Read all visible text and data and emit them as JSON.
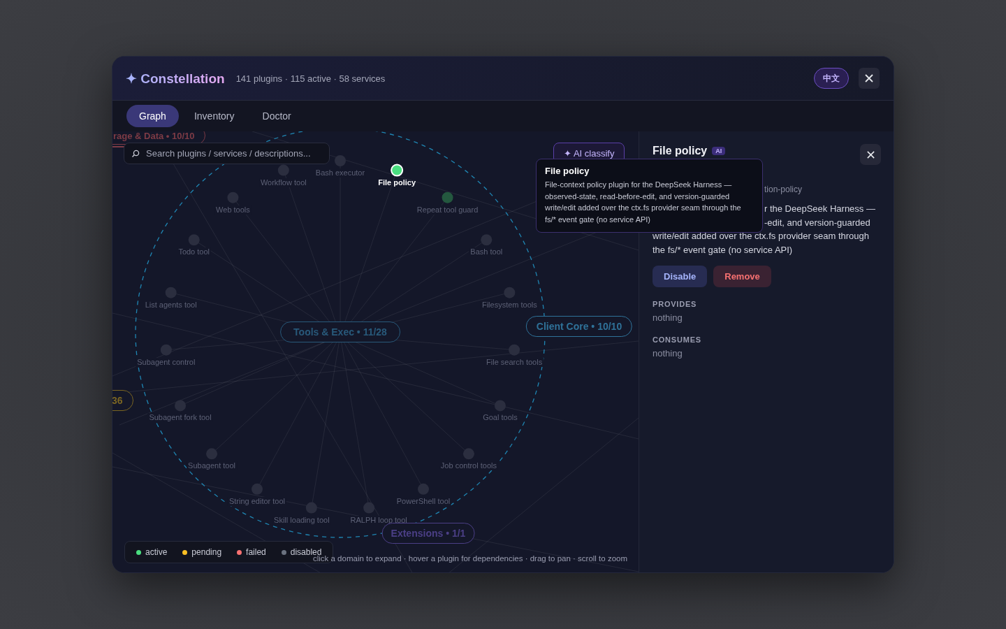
{
  "window": {
    "title": "✦ Constellation",
    "stats": "141 plugins · 115 active · 58 services",
    "language_button": "中文"
  },
  "tabs": [
    {
      "label": "Graph",
      "selected": true
    },
    {
      "label": "Inventory",
      "selected": false
    },
    {
      "label": "Doctor",
      "selected": false
    }
  ],
  "graph": {
    "search": {
      "placeholder": "Search plugins / services / descriptions..."
    },
    "ai_button": "✦ AI classify",
    "domains": [
      {
        "label": "rage & Data • 10/10",
        "color": "#7d3b45",
        "expanded": false
      },
      {
        "label": "Client Core • 10/10",
        "color": "#2f7299",
        "expanded": false
      },
      {
        "label": "Tools & Exec • 11/28",
        "color": "#28597a",
        "expanded": true
      },
      {
        "label": "36",
        "color": "#7a6522",
        "expanded": false
      },
      {
        "label": "Extensions • 1/1",
        "color": "#4b3f86",
        "expanded": false
      }
    ],
    "plugins": [
      {
        "name": "Bash executor",
        "color": "#2b2e3f",
        "dimmed": true
      },
      {
        "name": "Workflow tool",
        "color": "#2b2e3f",
        "dimmed": true
      },
      {
        "name": "File policy",
        "color": "#4ade80",
        "dimmed": false
      },
      {
        "name": "Web tools",
        "color": "#2b2e3f",
        "dimmed": true
      },
      {
        "name": "Repeat tool guard",
        "color": "#24583f",
        "dimmed": true
      },
      {
        "name": "Todo tool",
        "color": "#2b2e3f",
        "dimmed": true
      },
      {
        "name": "Bash tool",
        "color": "#2b2e3f",
        "dimmed": true
      },
      {
        "name": "List agents tool",
        "color": "#2b2e3f",
        "dimmed": true
      },
      {
        "name": "Filesystem tools",
        "color": "#2b2e3f",
        "dimmed": true
      },
      {
        "name": "Subagent control",
        "color": "#2b2e3f",
        "dimmed": true
      },
      {
        "name": "File search tools",
        "color": "#2b2e3f",
        "dimmed": true
      },
      {
        "name": "Subagent fork tool",
        "color": "#2b2e3f",
        "dimmed": true
      },
      {
        "name": "Goal tools",
        "color": "#2b2e3f",
        "dimmed": true
      },
      {
        "name": "Subagent tool",
        "color": "#2b2e3f",
        "dimmed": true
      },
      {
        "name": "Job control tools",
        "color": "#2b2e3f",
        "dimmed": true
      },
      {
        "name": "String editor tool",
        "color": "#2b2e3f",
        "dimmed": true
      },
      {
        "name": "PowerShell tool",
        "color": "#2b2e3f",
        "dimmed": true
      },
      {
        "name": "Skill loading tool",
        "color": "#2b2e3f",
        "dimmed": true
      },
      {
        "name": "RALPH loop tool",
        "color": "#2b2e3f",
        "dimmed": true
      }
    ],
    "legend": [
      {
        "label": "active",
        "color": "#4ade80"
      },
      {
        "label": "pending",
        "color": "#fbbf24"
      },
      {
        "label": "failed",
        "color": "#f87171"
      },
      {
        "label": "disabled",
        "color": "#6b7280"
      }
    ],
    "hint": "click a domain to expand · hover a plugin for dependencies · drag to pan · scroll to zoom"
  },
  "tooltip": {
    "title": "File policy",
    "description": "File-context policy plugin for the DeepSeek Harness — observed-state, read-before-edit, and version-guarded write/edit added over the ctx.fs provider seam through the fs/* event gate (no service API)"
  },
  "detail": {
    "title": "File policy",
    "badge": "AI",
    "id_fragment": "tion-policy",
    "description_lines": [
      {
        "text": "r the DeepSeek Harness —",
        "partial": true
      },
      {
        "text": "-edit, and version-guarded",
        "partial": true
      },
      {
        "text": "write/edit added over the ctx.fs provider seam through",
        "partial": false
      },
      {
        "text": "the fs/* event gate (no service API)",
        "partial": false
      }
    ],
    "buttons": [
      {
        "label": "Disable",
        "kind": "primary"
      },
      {
        "label": "Remove",
        "kind": "danger"
      }
    ],
    "sections": [
      {
        "heading": "PROVIDES",
        "value": "nothing"
      },
      {
        "heading": "CONSUMES",
        "value": "nothing"
      }
    ]
  }
}
